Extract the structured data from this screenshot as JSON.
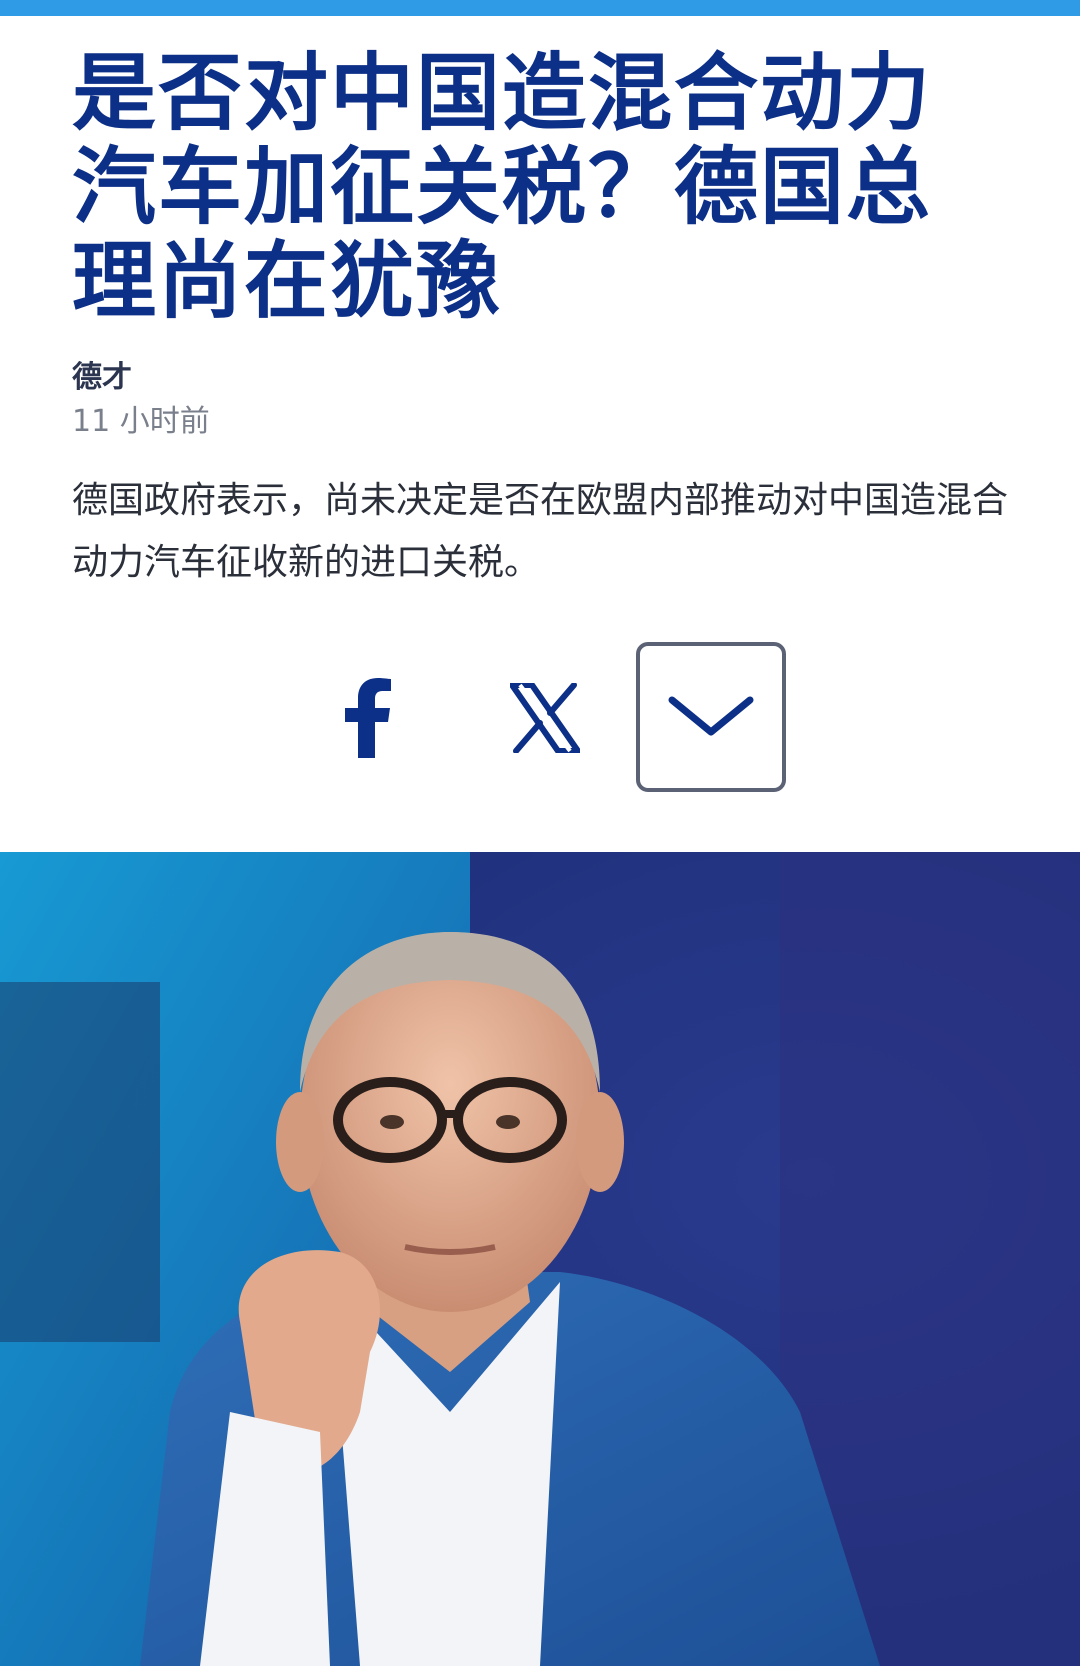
{
  "article": {
    "headline": "是否对中国造混合动力汽车加征关税？德国总理尚在犹豫",
    "author": "德才",
    "timestamp": "11 小时前",
    "summary": "德国政府表示，尚未决定是否在欧盟内部推动对中国造混合动力汽车征收新的进口关税。"
  },
  "share": {
    "icons": [
      "facebook-icon",
      "x-icon",
      "chevron-down-icon"
    ]
  },
  "colors": {
    "headline": "#0c2f87",
    "accent_bar": "#2f9be6",
    "icon": "#0c2f87"
  }
}
